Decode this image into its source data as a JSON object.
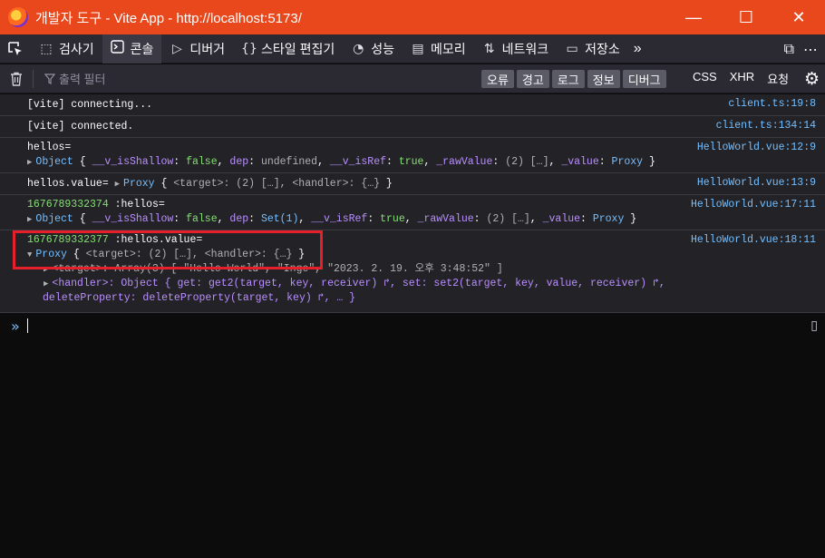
{
  "window": {
    "title": "개발자 도구 - Vite App - http://localhost:5173/",
    "controls": {
      "minimize": "—",
      "maximize": "☐",
      "close": "✕"
    }
  },
  "toolbar": {
    "tabs": [
      {
        "label": "검사기",
        "icon": "inspector-icon",
        "glyph": "⬚"
      },
      {
        "label": "콘솔",
        "icon": "console-icon",
        "glyph": "▶",
        "active": true
      },
      {
        "label": "디버거",
        "icon": "debugger-icon",
        "glyph": "▷"
      },
      {
        "label": "스타일 편집기",
        "icon": "style-editor-icon",
        "glyph": "{}"
      },
      {
        "label": "성능",
        "icon": "performance-icon",
        "glyph": "◔"
      },
      {
        "label": "메모리",
        "icon": "memory-icon",
        "glyph": "▤"
      },
      {
        "label": "네트워크",
        "icon": "network-icon",
        "glyph": "⇅"
      },
      {
        "label": "저장소",
        "icon": "storage-icon",
        "glyph": "▭"
      }
    ],
    "more_glyph": "»",
    "dock_glyph": "⧉",
    "menu_glyph": "⋯"
  },
  "filterbar": {
    "placeholder": "출력 필터",
    "levels": [
      "오류",
      "경고",
      "로그",
      "정보",
      "디버그"
    ],
    "types": [
      "CSS",
      "XHR",
      "요청"
    ]
  },
  "console": {
    "messages": [
      {
        "text": "[vite] connecting...",
        "location": "client.ts:19:8"
      },
      {
        "text": "[vite] connected.",
        "location": "client.ts:134:14"
      },
      {
        "location": "HelloWorld.vue:12:9"
      },
      {
        "location": "HelloWorld.vue:13:9"
      },
      {
        "location": "HelloWorld.vue:17:11"
      },
      {
        "location": "HelloWorld.vue:18:11"
      }
    ],
    "m3_label": "hellos=",
    "m4_label": "hellos.value=",
    "m5_prefix": "1676789332374",
    "m5_label": ":hellos=",
    "m6_prefix": "1676789332377",
    "m6_label": ":hellos.value=",
    "target_line": "<target>: Array(3) [ \"Hello World\", \"Inge\", \"2023. 2. 19. 오후 3:48:52\" ]",
    "handler_line_1": "<handler>: Object { get: get2(target, key, receiver) ↱, set: set2(target, key, value, receiver) ↱,",
    "handler_line_2": "deleteProperty: deleteProperty(target, key) ↱, … }"
  },
  "input": {
    "prompt": "»"
  },
  "colors": {
    "titlebar": "#e8481c",
    "panel": "#2b2a33",
    "output": "#232327",
    "highlight_box": "#e5202b",
    "link": "#75bfff"
  }
}
